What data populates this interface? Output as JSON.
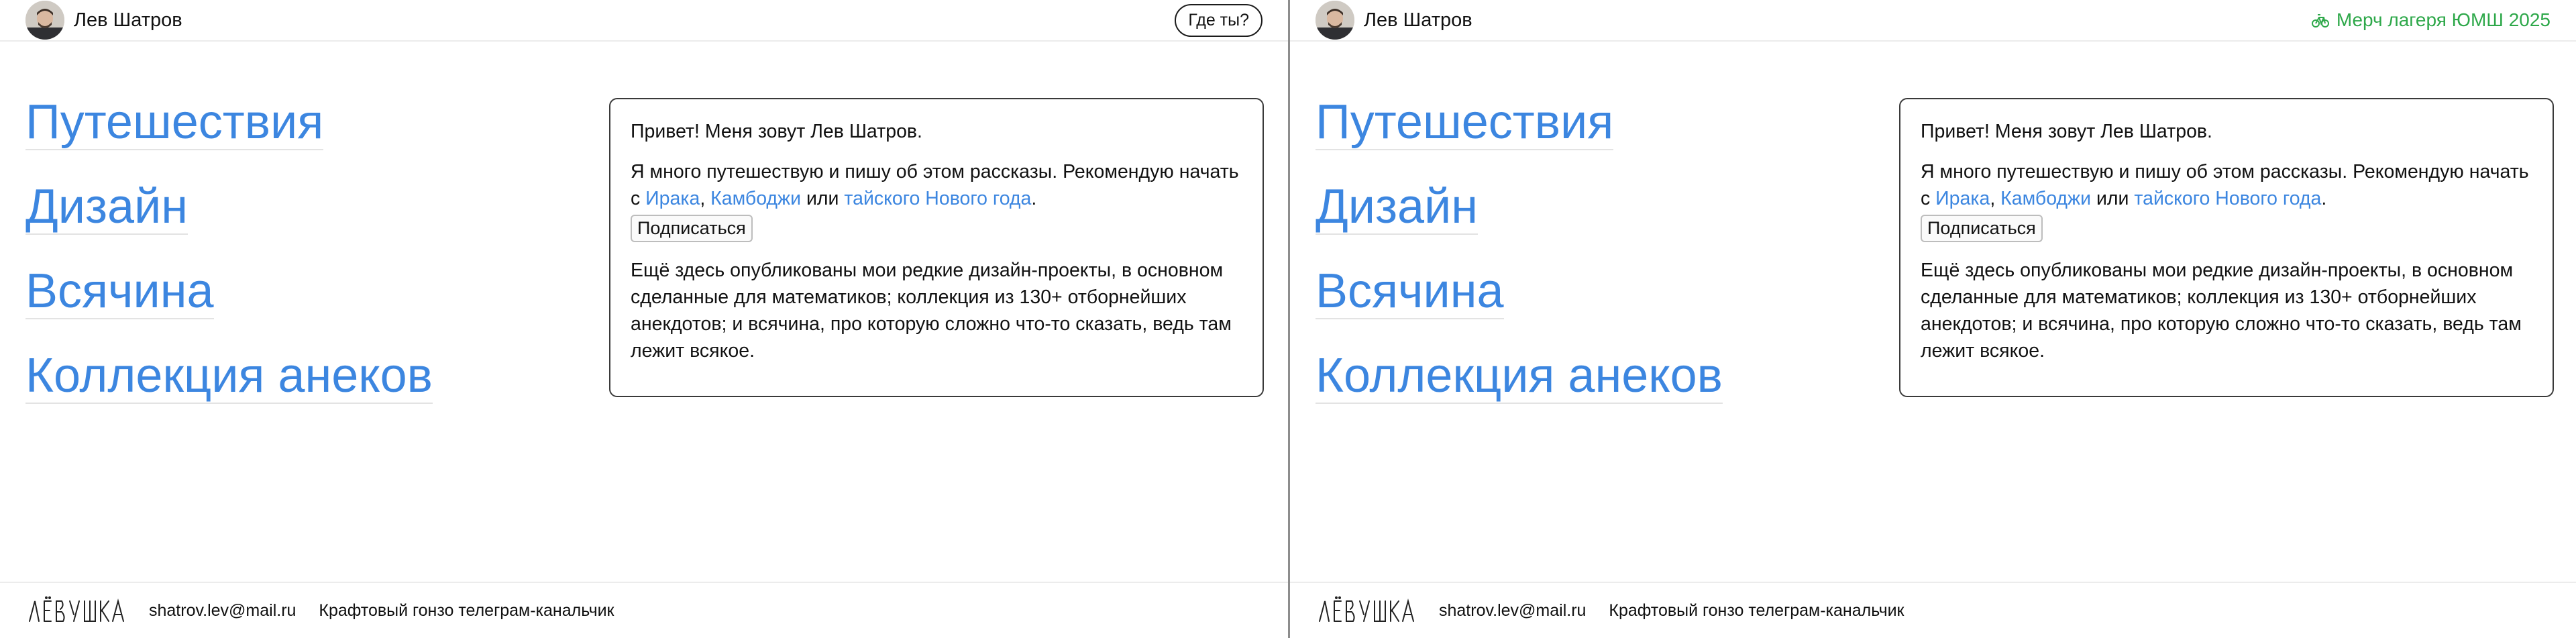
{
  "left": {
    "header": {
      "name": "Лев Шатров",
      "right_button": "Где ты?"
    },
    "nav": [
      "Путешествия",
      "Дизайн",
      "Всячина",
      "Коллекция анеков"
    ],
    "intro": {
      "greeting": "Привет! Меня зовут Лев Шатров.",
      "p2_start": "Я много путешествую и пишу об этом рассказы. Рекомендую начать с ",
      "link_iraq": "Ирака",
      "sep1": ", ",
      "link_cambodia": "Камбоджи",
      "sep2": " или ",
      "link_newyear": "тайского Нового года",
      "sep3": ".",
      "subscribe": "Подписаться",
      "p3": "Ещё здесь опубликованы мои редкие дизайн-проекты, в основном сделанные для математиков; коллекция из 130+ отборнейших анекдотов; и всячина, про которую сложно что-то сказать, ведь там лежит всякое."
    },
    "footer": {
      "signature": "Лёвушка",
      "email": "shatrov.lev@mail.ru",
      "channel": "Крафтовый гонзо телеграм-канальчик"
    }
  },
  "right": {
    "header": {
      "name": "Лев Шатров",
      "right_link": "Мерч лагеря ЮМШ 2025",
      "right_link_color": "#2ea84a"
    },
    "nav": [
      "Путешествия",
      "Дизайн",
      "Всячина",
      "Коллекция анеков"
    ],
    "intro": {
      "greeting": "Привет! Меня зовут Лев Шатров.",
      "p2_start": "Я много путешествую и пишу об этом рассказы. Рекомендую начать с ",
      "link_iraq": "Ирака",
      "sep1": ", ",
      "link_cambodia": "Камбоджи",
      "sep2": " или ",
      "link_newyear": "тайского Нового года",
      "sep3": ".",
      "subscribe": "Подписаться",
      "p3": "Ещё здесь опубликованы мои редкие дизайн-проекты, в основном сделанные для математиков; коллекция из 130+ отборнейших анекдотов; и всячина, про которую сложно что-то сказать, ведь там лежит всякое."
    },
    "footer": {
      "signature": "Лёвушка",
      "email": "shatrov.lev@mail.ru",
      "channel": "Крафтовый гонзо телеграм-канальчик"
    }
  },
  "colors": {
    "link": "#3c86e0",
    "merch": "#2ea84a"
  },
  "icons": [
    "avatar-photo",
    "bicycle-icon",
    "signature-logo"
  ]
}
